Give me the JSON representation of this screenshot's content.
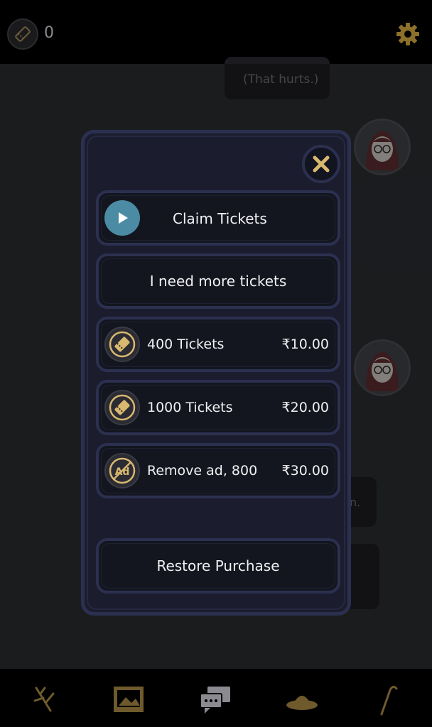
{
  "header": {
    "ticket_count": "0",
    "ticket_icon": "ticket-icon",
    "settings_icon": "gear-icon"
  },
  "chat": {
    "bubble_top_text": "(That hurts.)",
    "bubble_partial_text": "n."
  },
  "modal": {
    "close_icon": "close-icon",
    "claim": {
      "label": "Claim Tickets",
      "icon": "play-icon"
    },
    "more": {
      "label": "I need more tickets"
    },
    "items": [
      {
        "label": "400 Tickets",
        "price": "₹10.00",
        "icon": "ticket-icon"
      },
      {
        "label": "1000 Tickets",
        "price": "₹20.00",
        "icon": "ticket-icon"
      },
      {
        "label": "Remove ad, 800",
        "price": "₹30.00",
        "icon": "no-ad-icon"
      }
    ],
    "restore": {
      "label": "Restore Purchase"
    }
  },
  "nav": {
    "items": [
      "branch-icon",
      "image-icon",
      "chat-icon",
      "hat-icon",
      "cane-icon"
    ]
  },
  "colors": {
    "accent_gold": "#d9b870",
    "play_blue": "#4b8ba4",
    "modal_bg": "#1b1d2e",
    "modal_border": "#2c3050"
  }
}
